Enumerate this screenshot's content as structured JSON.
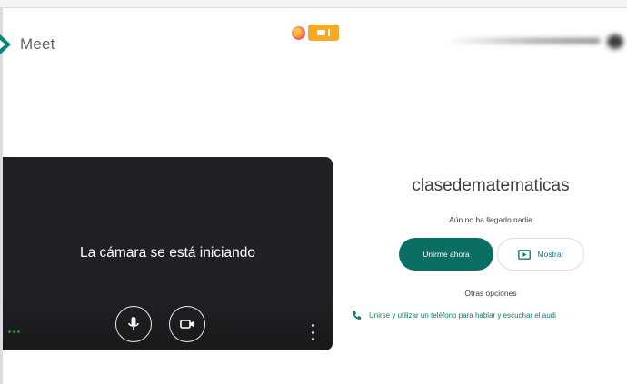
{
  "app": {
    "name": "Meet"
  },
  "colors": {
    "primary": "#0b6e62",
    "preview_bg": "#202124",
    "recording_indicator": "#f9a825"
  },
  "browser": {
    "sharing_indicator_icons": [
      "firefox-icon",
      "camera-icon",
      "microphone-icon"
    ]
  },
  "preview": {
    "status_text": "La cámara se está iniciando",
    "controls": {
      "microphone": "microphone-icon",
      "camera": "camera-icon",
      "more": "more-vert-icon",
      "effects": "effects-icon"
    }
  },
  "join_panel": {
    "meeting_name": "clasedematematicas",
    "participants_status": "Aún no ha llegado nadie",
    "join_label": "Unirme ahora",
    "present_label": "Mostrar",
    "other_options_label": "Otras opciones",
    "phone_option_label": "Unirse y utilizar un teléfono para hablar y escuchar el audi"
  }
}
